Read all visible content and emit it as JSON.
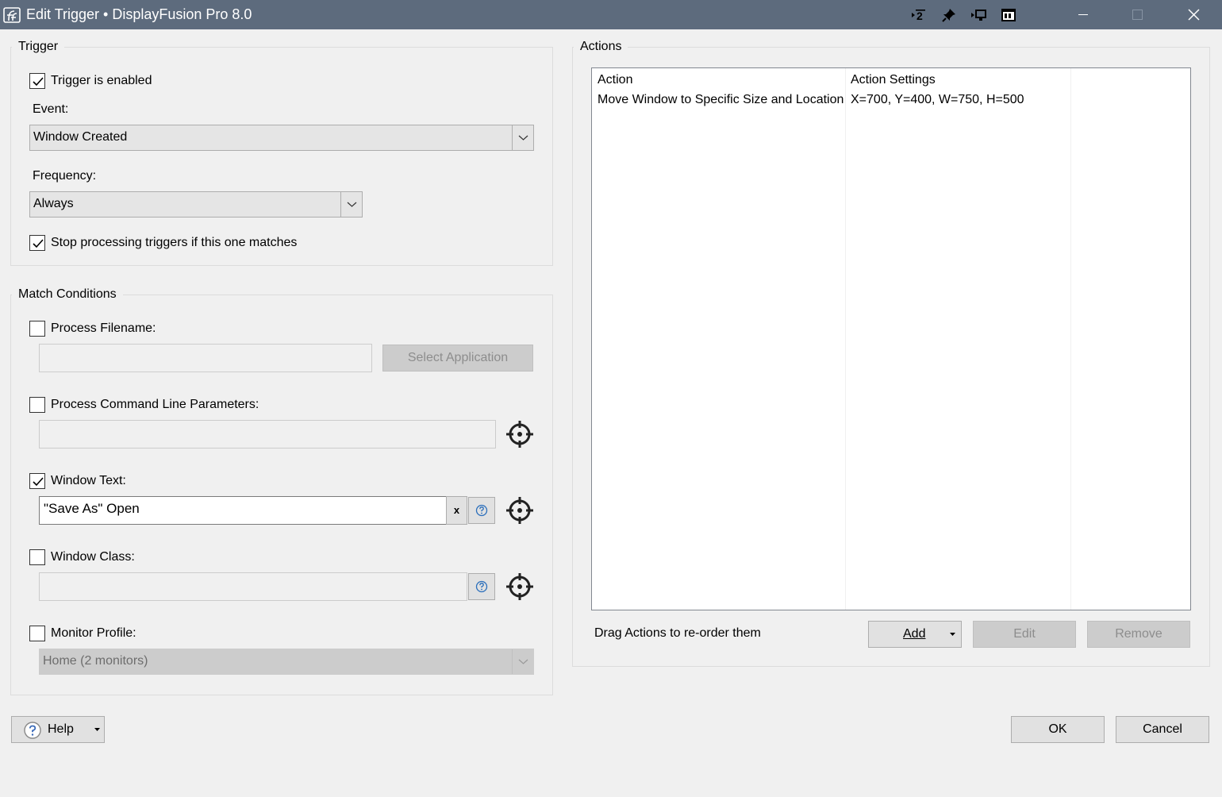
{
  "window": {
    "title": "Edit Trigger • DisplayFusion Pro 8.0"
  },
  "titlebar_icons": [
    "move-to-next-monitor-icon",
    "pin-icon",
    "monitor-arrow-icon",
    "monitor-config-icon"
  ],
  "trigger": {
    "group_label": "Trigger",
    "enabled_label": "Trigger is enabled",
    "enabled_checked": true,
    "event_label": "Event:",
    "event_value": "Window Created",
    "frequency_label": "Frequency:",
    "frequency_value": "Always",
    "stop_label": "Stop processing triggers if this one matches",
    "stop_checked": true
  },
  "match": {
    "group_label": "Match Conditions",
    "process_filename_label": "Process Filename:",
    "process_filename_checked": false,
    "process_filename_value": "",
    "select_application_label": "Select Application",
    "cmdline_label": "Process Command Line Parameters:",
    "cmdline_checked": false,
    "cmdline_value": "",
    "window_text_label": "Window Text:",
    "window_text_checked": true,
    "window_text_value": "\"Save As\" Open",
    "clear_glyph": "x",
    "window_class_label": "Window Class:",
    "window_class_checked": false,
    "window_class_value": "",
    "monitor_profile_label": "Monitor Profile:",
    "monitor_profile_checked": false,
    "monitor_profile_value": "Home (2 monitors)"
  },
  "actions": {
    "group_label": "Actions",
    "columns": [
      "Action",
      "Action Settings"
    ],
    "rows": [
      {
        "action": "Move Window to Specific Size and Location",
        "settings": "X=700, Y=400, W=750, H=500"
      }
    ],
    "hint": "Drag Actions to re-order them",
    "add_label": "Add",
    "edit_label": "Edit",
    "remove_label": "Remove"
  },
  "footer": {
    "help_label": "Help",
    "ok_label": "OK",
    "cancel_label": "Cancel"
  }
}
